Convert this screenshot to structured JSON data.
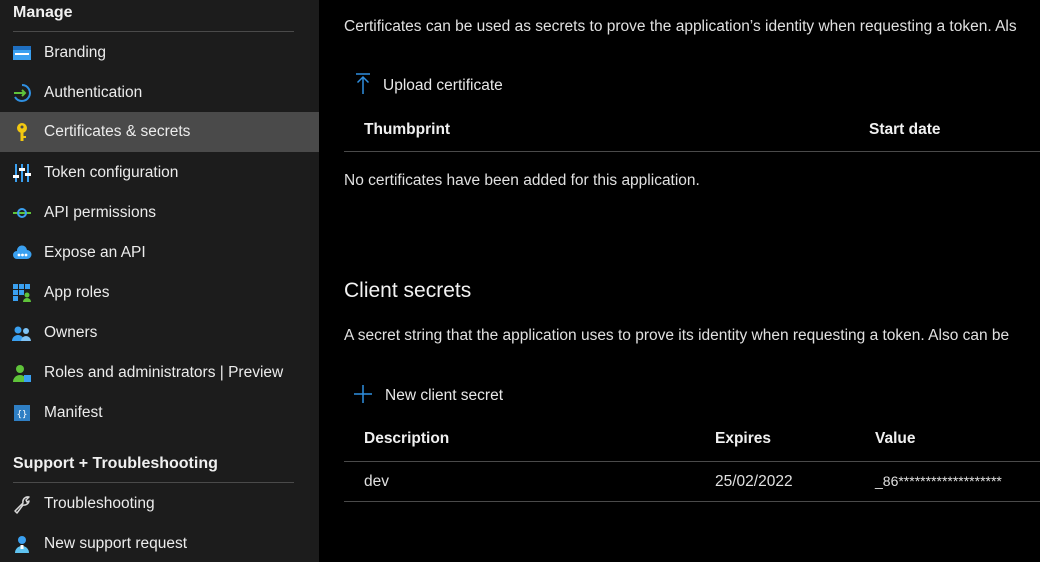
{
  "sidebar": {
    "manage_header": "Manage",
    "manage_items": [
      {
        "label": "Branding",
        "icon": "branding-icon"
      },
      {
        "label": "Authentication",
        "icon": "authentication-icon"
      },
      {
        "label": "Certificates & secrets",
        "icon": "key-icon",
        "active": true
      },
      {
        "label": "Token configuration",
        "icon": "token-configuration-icon"
      },
      {
        "label": "API permissions",
        "icon": "api-permissions-icon"
      },
      {
        "label": "Expose an API",
        "icon": "cloud-api-icon"
      },
      {
        "label": "App roles",
        "icon": "app-roles-icon"
      },
      {
        "label": "Owners",
        "icon": "owners-icon"
      },
      {
        "label": "Roles and administrators | Preview",
        "icon": "roles-admin-icon"
      },
      {
        "label": "Manifest",
        "icon": "manifest-icon"
      }
    ],
    "support_header": "Support + Troubleshooting",
    "support_items": [
      {
        "label": "Troubleshooting",
        "icon": "wrench-icon"
      },
      {
        "label": "New support request",
        "icon": "support-person-icon"
      }
    ]
  },
  "certificates": {
    "description": "Certificates can be used as secrets to prove the application’s identity when requesting a token. Als",
    "upload_label": "Upload certificate",
    "columns": [
      "Thumbprint",
      "Start date"
    ],
    "empty_message": "No certificates have been added for this application."
  },
  "client_secrets": {
    "title": "Client secrets",
    "description": "A secret string that the application uses to prove its identity when requesting a token. Also can be",
    "new_label": "New client secret",
    "columns": [
      "Description",
      "Expires",
      "Value"
    ],
    "rows": [
      {
        "description": "dev",
        "expires": "25/02/2022",
        "value": "_86*******************"
      }
    ]
  },
  "colors": {
    "accent": "#2f8fe0",
    "active_item_bg": "#4a4a4a",
    "sidebar_bg": "#1c1c1c",
    "main_bg": "#000000"
  }
}
